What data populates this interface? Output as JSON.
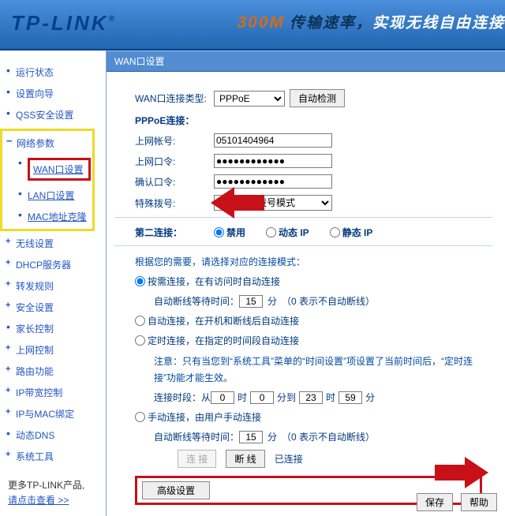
{
  "banner": {
    "logo": "TP-LINK",
    "tag_300m": "300M",
    "tag_a": "传输速率，",
    "tag_b": "实现无线自由连接"
  },
  "sidebar": {
    "items": [
      {
        "label": "运行状态",
        "type": "item"
      },
      {
        "label": "设置向导",
        "type": "item"
      },
      {
        "label": "QSS安全设置",
        "type": "item"
      },
      {
        "label": "网络参数",
        "type": "group-open"
      },
      {
        "label": "无线设置",
        "type": "group"
      },
      {
        "label": "DHCP服务器",
        "type": "group"
      },
      {
        "label": "转发规则",
        "type": "group"
      },
      {
        "label": "安全设置",
        "type": "group"
      },
      {
        "label": "家长控制",
        "type": "item"
      },
      {
        "label": "上网控制",
        "type": "group"
      },
      {
        "label": "路由功能",
        "type": "group"
      },
      {
        "label": "IP带宽控制",
        "type": "group"
      },
      {
        "label": "IP与MAC绑定",
        "type": "group"
      },
      {
        "label": "动态DNS",
        "type": "item"
      },
      {
        "label": "系统工具",
        "type": "group"
      }
    ],
    "sub": [
      {
        "label": "WAN口设置",
        "active": true
      },
      {
        "label": "LAN口设置"
      },
      {
        "label": "MAC地址克隆"
      }
    ],
    "more_line1": "更多TP-LINK产品,",
    "more_line2": "请点击查看 >>"
  },
  "panel": {
    "title": "WAN口设置",
    "conn_type_label": "WAN口连接类型:",
    "conn_type_value": "PPPoE",
    "auto_detect": "自动检测",
    "pppoe_heading": "PPPoE连接：",
    "user_label": "上网帐号:",
    "user_value": "05101404964",
    "pass_label": "上网口令:",
    "pass_value": "●●●●●●●●●●●●",
    "confirm_label": "确认口令:",
    "confirm_value": "●●●●●●●●●●●●",
    "dial_label": "特殊拨号:",
    "dial_value": "自动选择拨号模式",
    "second_label": "第二连接：",
    "r_disable": "禁用",
    "r_dyn": "动态 IP",
    "r_static": "静态 IP",
    "mode_intro": "根据您的需要，请选择对应的连接模式：",
    "mode1": "按需连接，在有访问时自动连接",
    "wait_label": "自动断线等待时间：",
    "wait_minutes": "分",
    "wait_hint": "（0 表示不自动断线）",
    "wait_val_1": "15",
    "mode2": "自动连接，在开机和断线后自动连接",
    "mode3": "定时连接，在指定的时间段自动连接",
    "note": "注意：只有当您到“系统工具”菜单的“时间设置”项设置了当前时间后，“定时连接”功能才能生效。",
    "period_label": "连接时段：从",
    "h": "时",
    "m": "分",
    "to": "分到",
    "p_h1": "0",
    "p_m1": "0",
    "p_h2": "23",
    "p_m2": "59",
    "mode4": "手动连接，由用户手动连接",
    "wait_val_2": "15",
    "btn_connect": "连 接",
    "btn_disconnect": "断 线",
    "status": "已连接",
    "btn_advanced": "高级设置",
    "btn_save": "保存",
    "btn_help": "帮助"
  }
}
